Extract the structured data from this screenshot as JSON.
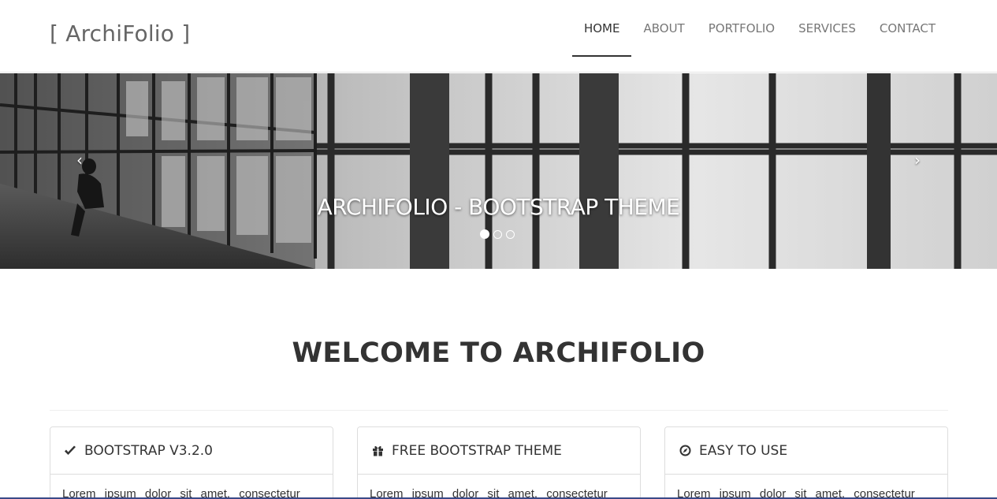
{
  "navbar": {
    "brand": "[ ArchiFolio ]",
    "items": [
      {
        "label": "HOME",
        "active": true
      },
      {
        "label": "ABOUT",
        "active": false
      },
      {
        "label": "PORTFOLIO",
        "active": false
      },
      {
        "label": "SERVICES",
        "active": false
      },
      {
        "label": "CONTACT",
        "active": false
      }
    ]
  },
  "carousel": {
    "caption": "ARCHIFOLIO - BOOTSTRAP THEME",
    "slide_count": 3,
    "active_slide": 1,
    "prev_icon": "chevron-left-icon",
    "next_icon": "chevron-right-icon"
  },
  "welcome": {
    "title": "WELCOME TO ARCHIFOLIO"
  },
  "panels": [
    {
      "icon": "check-icon",
      "title": "BOOTSTRAP V3.2.0",
      "body": "Lorem ipsum dolor sit amet, consectetur"
    },
    {
      "icon": "gift-icon",
      "title": "FREE BOOTSTRAP THEME",
      "body": "Lorem ipsum dolor sit amet, consectetur"
    },
    {
      "icon": "compass-icon",
      "title": "EASY TO USE",
      "body": "Lorem ipsum dolor sit amet, consectetur"
    }
  ],
  "colors": {
    "text": "#333333",
    "nav_muted": "#777777",
    "border": "#dddddd"
  }
}
